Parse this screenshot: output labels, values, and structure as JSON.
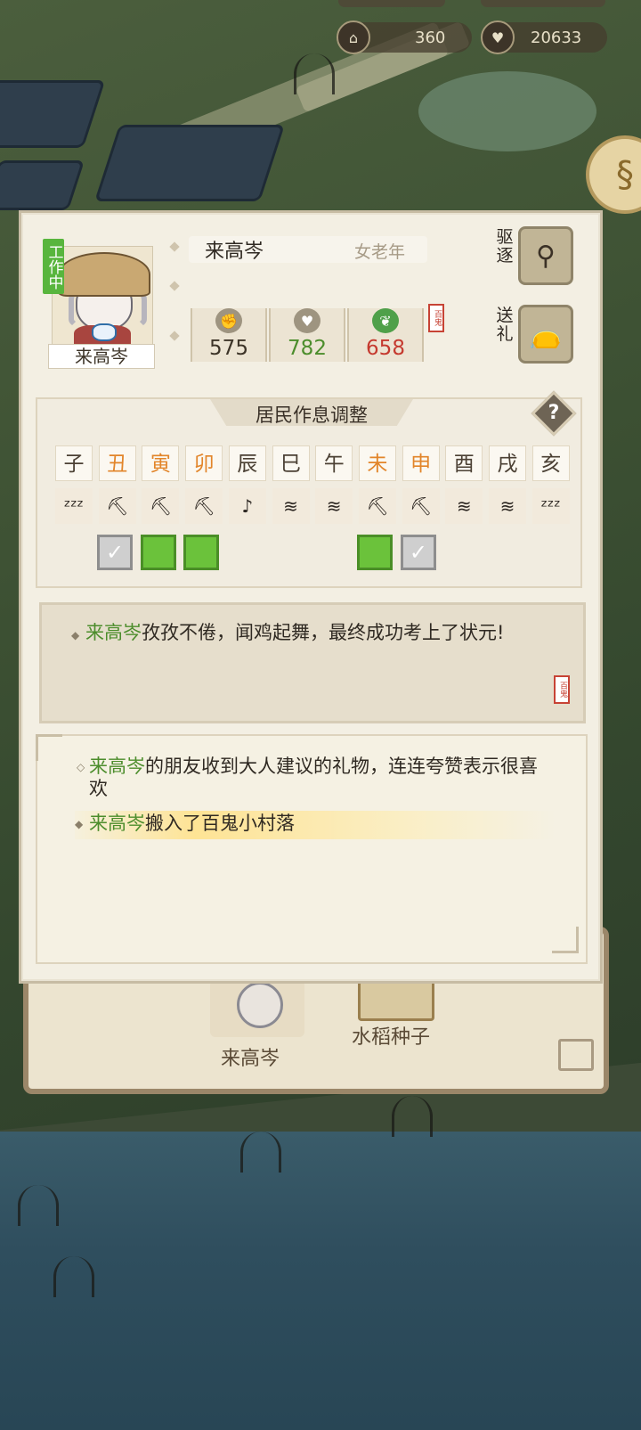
{
  "hud": {
    "resources": [
      {
        "icon": "temple-icon",
        "value": "360"
      },
      {
        "icon": "heart-icon",
        "value": "20633"
      }
    ]
  },
  "character": {
    "status_tag": "工作中",
    "name": "来高岑",
    "type": "女老年",
    "stats": [
      {
        "icon": "strength-icon",
        "value": "575",
        "color": "#3d3428"
      },
      {
        "icon": "heart-icon",
        "value": "782",
        "color": "#4c8d2c"
      },
      {
        "icon": "sprout-icon",
        "value": "658",
        "color": "#c53a2f"
      }
    ],
    "seal_text": "百鬼"
  },
  "actions": {
    "expel_label": "驱逐",
    "gift_label": "送礼"
  },
  "schedule": {
    "title": "居民作息调整",
    "help": "?",
    "hours": [
      {
        "label": "子",
        "highlight": false
      },
      {
        "label": "丑",
        "highlight": true
      },
      {
        "label": "寅",
        "highlight": true
      },
      {
        "label": "卯",
        "highlight": true
      },
      {
        "label": "辰",
        "highlight": false
      },
      {
        "label": "巳",
        "highlight": false
      },
      {
        "label": "午",
        "highlight": false
      },
      {
        "label": "未",
        "highlight": true
      },
      {
        "label": "申",
        "highlight": true
      },
      {
        "label": "酉",
        "highlight": false
      },
      {
        "label": "戌",
        "highlight": false
      },
      {
        "label": "亥",
        "highlight": false
      }
    ],
    "activities": [
      {
        "type": "sleep",
        "glyph": "ᶻᶻᶻ"
      },
      {
        "type": "work",
        "glyph": "⛏"
      },
      {
        "type": "work",
        "glyph": "⛏"
      },
      {
        "type": "work",
        "glyph": "⛏"
      },
      {
        "type": "leisure",
        "glyph": "♪"
      },
      {
        "type": "eat",
        "glyph": "≋"
      },
      {
        "type": "eat",
        "glyph": "≋"
      },
      {
        "type": "work",
        "glyph": "⛏"
      },
      {
        "type": "work",
        "glyph": "⛏"
      },
      {
        "type": "eat",
        "glyph": "≋"
      },
      {
        "type": "eat",
        "glyph": "≋"
      },
      {
        "type": "sleep",
        "glyph": "ᶻᶻᶻ"
      }
    ],
    "checks": [
      {
        "slot": 1,
        "state": "checked"
      },
      {
        "slot": 2,
        "state": "active"
      },
      {
        "slot": 3,
        "state": "active"
      },
      {
        "slot": 7,
        "state": "active"
      },
      {
        "slot": 8,
        "state": "checked"
      }
    ]
  },
  "story": {
    "name": "来高岑",
    "text": "孜孜不倦，闻鸡起舞，最终成功考上了状元!"
  },
  "log": [
    {
      "name": "来高岑",
      "text": "的朋友收到大人建议的礼物，连连夸赞表示很喜欢"
    },
    {
      "name": "来高岑",
      "text": "搬入了百鬼小村落"
    }
  ],
  "background": {
    "labels": [
      "来高岑",
      "水稻种子"
    ]
  }
}
